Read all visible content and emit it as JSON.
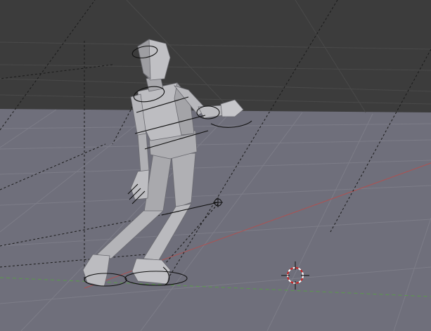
{
  "app": {
    "name": "3D viewport",
    "view": "perspective"
  },
  "scene": {
    "objects": [
      "character-mesh",
      "armature-rig",
      "ik-target",
      "3d-cursor"
    ],
    "grid_visible": true,
    "axis_x_color": "#b05050",
    "axis_y_color": "#5a9a4a"
  },
  "colors": {
    "background": "#3c3c3c",
    "floor": "#6f6f7b",
    "mesh": "#b9b9bd",
    "mesh_shadow": "#8e8e93",
    "grid_line": "#7b7b86",
    "cursor_red": "#cc2222"
  },
  "icons": {
    "cursor": "3d-cursor-icon",
    "target": "ik-target-icon"
  }
}
